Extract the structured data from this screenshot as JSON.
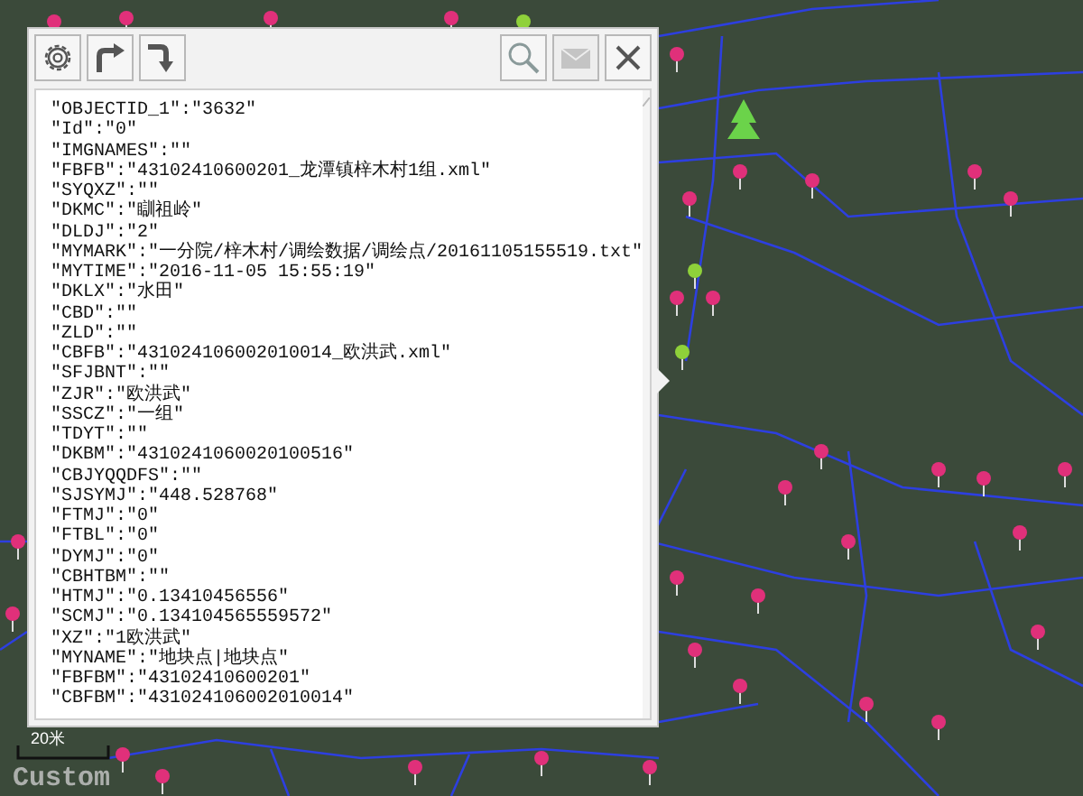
{
  "map": {
    "scale_label": "20米",
    "layer_label": "Custom"
  },
  "popup": {
    "toolbar": [
      {
        "kind": "settings",
        "disabled": false
      },
      {
        "kind": "redo",
        "disabled": false
      },
      {
        "kind": "turn",
        "disabled": false
      },
      {
        "kind": "search",
        "disabled": false
      },
      {
        "kind": "mail",
        "disabled": true
      },
      {
        "kind": "close",
        "disabled": false
      }
    ],
    "attributes": [
      "\"OBJECTID_1\":\"3632\"",
      "\"Id\":\"0\"",
      "\"IMGNAMES\":\"\"",
      "\"FBFB\":\"43102410600201_龙潭镇梓木村1组.xml\"",
      "\"SYQXZ\":\"\"",
      "\"DKMC\":\"瞓祖岭\"",
      "\"DLDJ\":\"2\"",
      "\"MYMARK\":\"一分院/梓木村/调绘数据/调绘点/20161105155519.txt\"",
      "\"MYTIME\":\"2016-11-05 15:55:19\"",
      "\"DKLX\":\"水田\"",
      "\"CBD\":\"\"",
      "\"ZLD\":\"\"",
      "\"CBFB\":\"431024106002010014_欧洪武.xml\"",
      "\"SFJBNT\":\"\"",
      "\"ZJR\":\"欧洪武\"",
      "\"SSCZ\":\"一组\"",
      "\"TDYT\":\"\"",
      "\"DKBM\":\"4310241060020100516\"",
      "\"CBJYQQDFS\":\"\"",
      "\"SJSYMJ\":\"448.528768\"",
      "\"FTMJ\":\"0\"",
      "\"FTBL\":\"0\"",
      "\"DYMJ\":\"0\"",
      "\"CBHTBM\":\"\"",
      "\"HTMJ\":\"0.13410456556\"",
      "\"SCMJ\":\"0.134104565559572\"",
      "\"XZ\":\"1欧洪武\"",
      "\"MYNAME\":\"地块点|地块点\"",
      "\"FBFBM\":\"43102410600201\"",
      "\"CBFBM\":\"431024106002010014\""
    ]
  }
}
